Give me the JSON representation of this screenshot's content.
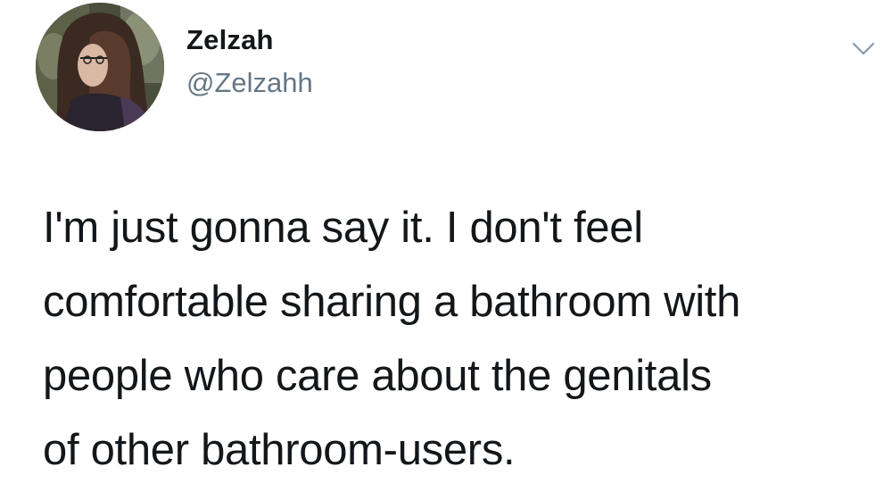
{
  "tweet": {
    "author": {
      "display_name": "Zelzah",
      "handle": "@Zelzahh"
    },
    "text_lines": [
      "I'm just gonna say it. I don't feel",
      "comfortable sharing a bathroom with",
      "people who care about the genitals",
      "of other bathroom-users."
    ],
    "icons": {
      "avatar": "profile-photo",
      "menu": "chevron-down-icon"
    },
    "colors": {
      "text": "#14171a",
      "secondary_text": "#657786",
      "background": "#ffffff"
    }
  }
}
